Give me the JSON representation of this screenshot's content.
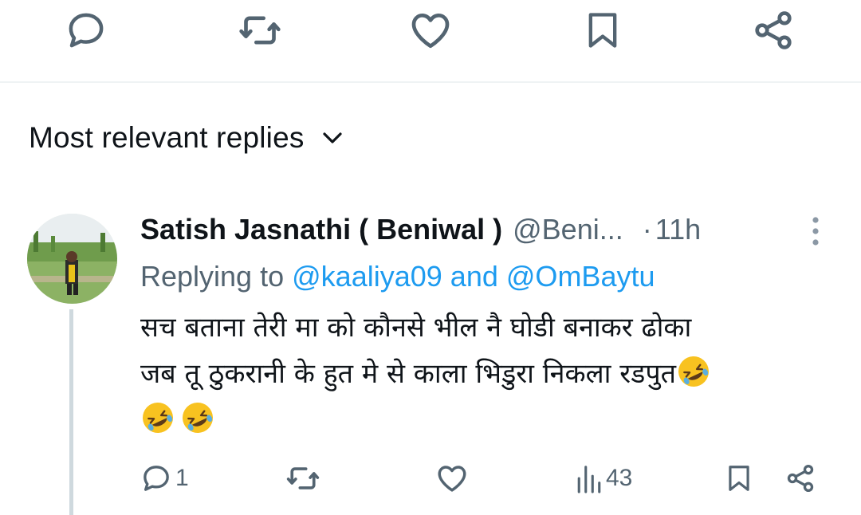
{
  "top_actions": {
    "reply": "reply-icon",
    "repost": "repost-icon",
    "like": "heart-icon",
    "bookmark": "bookmark-icon",
    "share": "share-icon"
  },
  "sort": {
    "label": "Most relevant replies",
    "icon": "chevron-down-icon"
  },
  "reply": {
    "display_name": "Satish Jasnathi ( Beniwal )",
    "handle": "@Beni...",
    "separator": "·",
    "time": "11h",
    "replying_label": "Replying to",
    "mention_1": "@kaaliya09",
    "and_text": "and",
    "mention_2": "@OmBaytu",
    "text_line_1": "सच बताना तेरी मा को कौनसे भील नै घोडी बनाकर ढोका",
    "text_line_2": "जब तू ठुकरानी के हुत मे से काला भिडुरा निकला रडपुत",
    "emoji": "rolling-on-floor-laughing",
    "actions": {
      "reply_count": "1",
      "views_count": "43"
    }
  },
  "colors": {
    "text_primary": "#0f1419",
    "text_secondary": "#536471",
    "link": "#1d9bf0",
    "divider": "#eff3f4",
    "thread_line": "#cfd9de"
  }
}
